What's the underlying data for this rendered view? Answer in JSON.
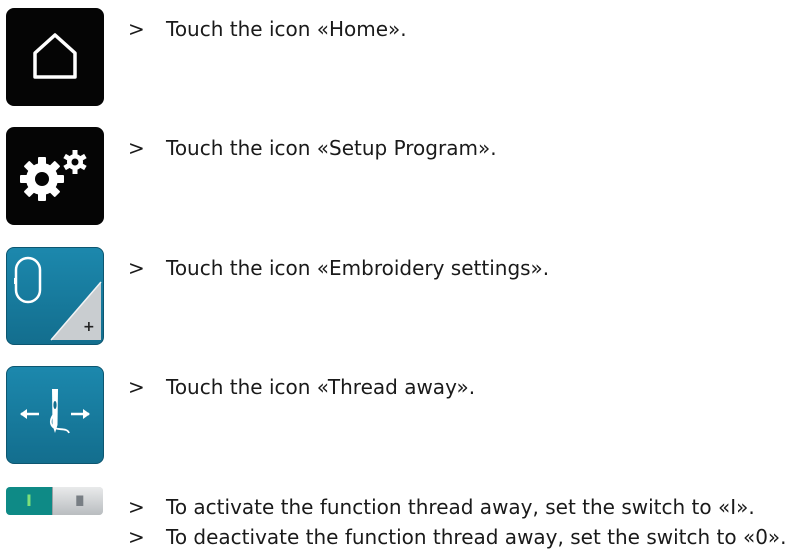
{
  "steps": [
    {
      "marker": ">",
      "text": "Touch the icon «Home»."
    },
    {
      "marker": ">",
      "text": "Touch the icon «Setup Program»."
    },
    {
      "marker": ">",
      "text": "Touch the icon «Embroidery settings»."
    },
    {
      "marker": ">",
      "text": "Touch the icon «Thread away»."
    },
    {
      "marker": ">",
      "text": "To activate the function thread away, set the switch to «I»."
    },
    {
      "marker": ">",
      "text": "To deactivate the function thread away, set the switch to «0»."
    }
  ],
  "icons": {
    "home": "home-icon",
    "setup": "gears-icon",
    "embroidery": "embroidery-hoop-icon",
    "thread_away": "needle-thread-away-icon",
    "switch": "toggle-switch"
  },
  "switch": {
    "on_label": "I",
    "grip": "III"
  },
  "colors": {
    "black_button": "#050505",
    "teal_button": "#1a82a6",
    "switch_on": "#0e8a86"
  }
}
